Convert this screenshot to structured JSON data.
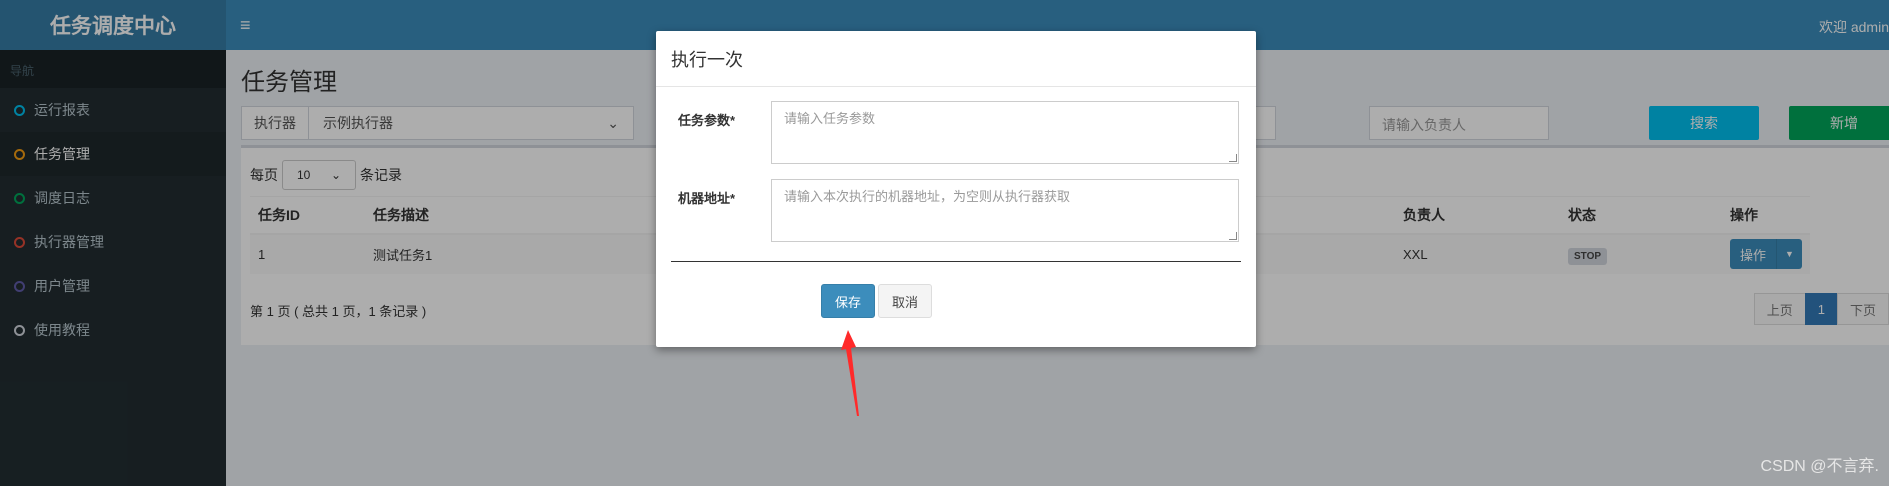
{
  "app": {
    "title": "任务调度中心",
    "welcome": "欢迎 admin"
  },
  "sidebar": {
    "header": "导航",
    "items": [
      {
        "label": "运行报表",
        "color": "#00c0ef"
      },
      {
        "label": "任务管理",
        "color": "#f39c12"
      },
      {
        "label": "调度日志",
        "color": "#00a65a"
      },
      {
        "label": "执行器管理",
        "color": "#dd4b39"
      },
      {
        "label": "用户管理",
        "color": "#605ca8"
      },
      {
        "label": "使用教程",
        "color": "#d2d6de"
      }
    ]
  },
  "page": {
    "title": "任务管理",
    "filter": {
      "executor_label": "执行器",
      "executor_value": "示例执行器",
      "owner_placeholder": "请输入负责人",
      "search_label": "搜索",
      "new_label": "新增"
    },
    "perpage": {
      "prefix": "每页",
      "value": "10",
      "suffix": "条记录"
    },
    "table": {
      "headers": {
        "id": "任务ID",
        "desc": "任务描述",
        "owner": "负责人",
        "status": "状态",
        "ops": "操作"
      },
      "row": {
        "id": "1",
        "desc": "测试任务1",
        "owner": "XXL",
        "status": "STOP",
        "op": "操作"
      }
    },
    "paging_text": "第 1 页 ( 总共 1 页，1 条记录 )",
    "pager": {
      "prev": "上页",
      "current": "1",
      "next": "下页"
    }
  },
  "modal": {
    "title": "执行一次",
    "param_label": "任务参数*",
    "param_placeholder": "请输入任务参数",
    "address_label": "机器地址*",
    "address_placeholder": "请输入本次执行的机器地址，为空则从执行器获取",
    "save_label": "保存",
    "cancel_label": "取消"
  },
  "watermark": "CSDN @不言弃."
}
